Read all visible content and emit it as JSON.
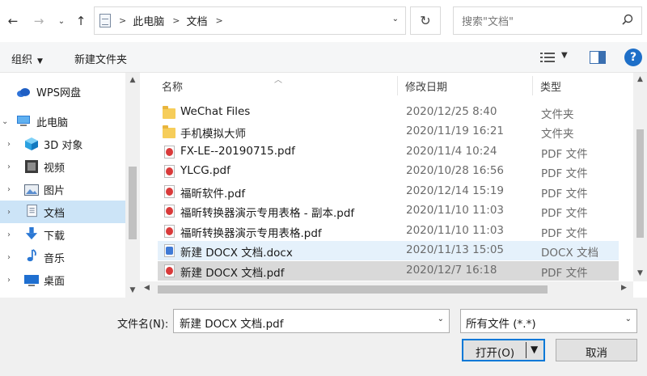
{
  "address_bar": {
    "breadcrumb": [
      "此电脑",
      "文档"
    ],
    "search_placeholder": "搜索\"文档\""
  },
  "toolbar": {
    "organize": "组织",
    "new_folder": "新建文件夹"
  },
  "nav": {
    "items": [
      {
        "label": "WPS网盘",
        "icon": "cloud-icon"
      },
      {
        "label": "此电脑",
        "icon": "computer-icon"
      },
      {
        "label": "3D 对象",
        "icon": "cube-icon"
      },
      {
        "label": "视频",
        "icon": "video-icon"
      },
      {
        "label": "图片",
        "icon": "picture-icon"
      },
      {
        "label": "文档",
        "icon": "document-icon",
        "selected": true
      },
      {
        "label": "下载",
        "icon": "download-icon"
      },
      {
        "label": "音乐",
        "icon": "music-icon"
      },
      {
        "label": "桌面",
        "icon": "desktop-icon"
      }
    ]
  },
  "columns": {
    "name": "名称",
    "date": "修改日期",
    "type": "类型"
  },
  "files": [
    {
      "name": "WeChat Files",
      "date": "2020/12/25 8:40",
      "type": "文件夹",
      "kind": "folder"
    },
    {
      "name": "手机模拟大师",
      "date": "2020/11/19 16:21",
      "type": "文件夹",
      "kind": "folder"
    },
    {
      "name": "FX-LE--20190715.pdf",
      "date": "2020/11/4 10:24",
      "type": "PDF 文件",
      "kind": "pdf"
    },
    {
      "name": "YLCG.pdf",
      "date": "2020/10/28 16:56",
      "type": "PDF 文件",
      "kind": "pdf"
    },
    {
      "name": "福昕软件.pdf",
      "date": "2020/12/14 15:19",
      "type": "PDF 文件",
      "kind": "pdf"
    },
    {
      "name": "福昕转换器演示专用表格 - 副本.pdf",
      "date": "2020/11/10 11:03",
      "type": "PDF 文件",
      "kind": "pdf"
    },
    {
      "name": "福昕转换器演示专用表格.pdf",
      "date": "2020/11/10 11:03",
      "type": "PDF 文件",
      "kind": "pdf"
    },
    {
      "name": "新建 DOCX 文档.docx",
      "date": "2020/11/13 15:05",
      "type": "DOCX 文档",
      "kind": "docx",
      "state": "hover"
    },
    {
      "name": "新建 DOCX 文档.pdf",
      "date": "2020/12/7 16:18",
      "type": "PDF 文件",
      "kind": "pdf",
      "state": "selected"
    }
  ],
  "footer": {
    "filename_label": "文件名(N):",
    "filename_value": "新建 DOCX 文档.pdf",
    "filter_value": "所有文件 (*.*)",
    "open_label": "打开(O)",
    "cancel_label": "取消"
  }
}
